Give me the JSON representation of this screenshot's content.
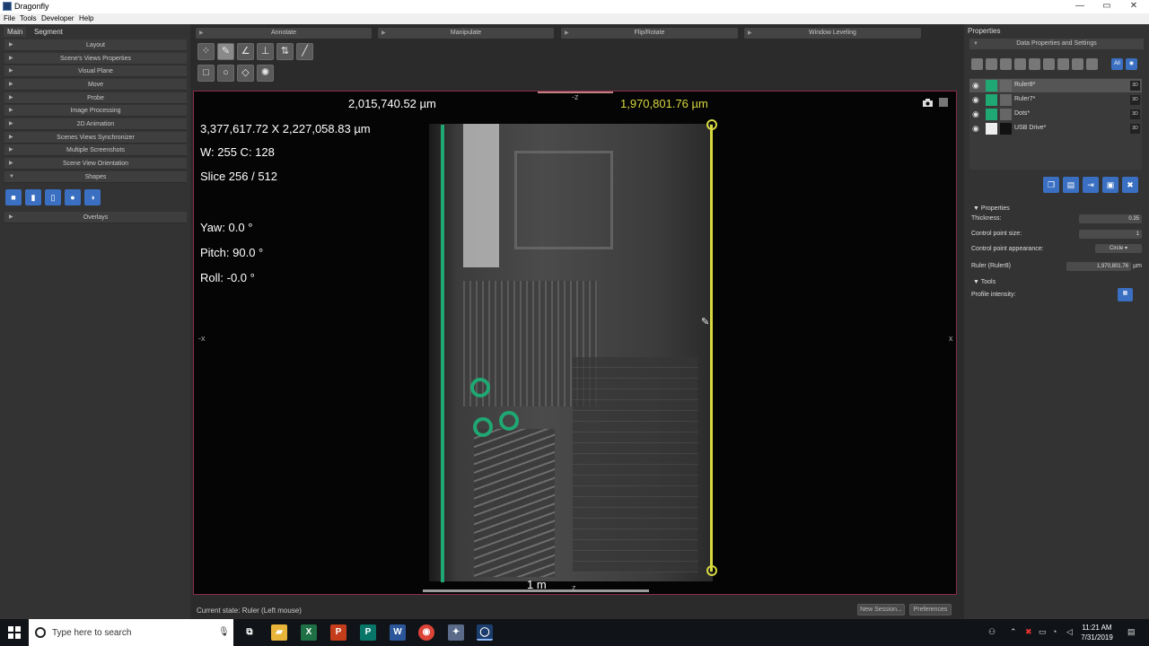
{
  "window": {
    "title": "Dragonfly",
    "min": "—",
    "max": "▭",
    "close": "✕"
  },
  "menu": [
    "File",
    "Tools",
    "Developer",
    "Help"
  ],
  "left_panel": {
    "tabs": [
      "Main",
      "Segment"
    ],
    "items": [
      "Layout",
      "Scene's Views Properties",
      "Visual Plane",
      "Move",
      "Probe",
      "Image Processing",
      "2D Animation",
      "Scenes Views Synchronizer",
      "Multiple Screenshots",
      "Scene View Orientation",
      "Shapes"
    ],
    "overlays": "Overlays"
  },
  "toolbar": {
    "sections": [
      "Annotate",
      "Manipulate",
      "Flip/Rotate",
      "Window Leveling"
    ]
  },
  "viewport": {
    "ruler_green_label": "2,015,740.52 µm",
    "ruler_yellow_label": "1,970,801.76 µm",
    "dimensions": "3,377,617.72 X 2,227,058.83 µm",
    "window_center": "W: 255 C: 128",
    "slice": "Slice 256 / 512",
    "yaw": "Yaw: 0.0 °",
    "pitch": "Pitch: 90.0 °",
    "roll": "Roll: -0.0 °",
    "scale": "1 m",
    "axis_top": "-z",
    "axis_bottom": "z",
    "axis_left": "-x",
    "axis_right": "x"
  },
  "status": {
    "current_state": "Current state: Ruler (Left mouse)",
    "new_session": "New Session...",
    "preferences": "Preferences"
  },
  "right_panel": {
    "title": "Properties",
    "header": "Data Properties and Settings",
    "filter_all": "All",
    "data_items": [
      {
        "name": "Ruler8*",
        "color": "#1fa873",
        "tag": "3D"
      },
      {
        "name": "Ruler7*",
        "color": "#1fa873",
        "tag": "3D"
      },
      {
        "name": "Dots*",
        "color": "#1fa873",
        "tag": "3D"
      },
      {
        "name": "USB Drive*",
        "color": "#eeeeee",
        "tag": "3D"
      }
    ],
    "properties_section": "Properties",
    "thickness_label": "Thickness:",
    "thickness_value": "0.35",
    "cp_size_label": "Control point size:",
    "cp_size_value": "1",
    "cp_appearance_label": "Control point appearance:",
    "cp_appearance_value": "Circle",
    "ruler_label": "Ruler (Ruler8)",
    "ruler_value": "1,970,801.76",
    "ruler_unit": "µm",
    "tools_section": "Tools",
    "profile_label": "Profile intensity:"
  },
  "taskbar": {
    "search_placeholder": "Type here to search",
    "time": "11:21 AM",
    "date": "7/31/2019"
  }
}
